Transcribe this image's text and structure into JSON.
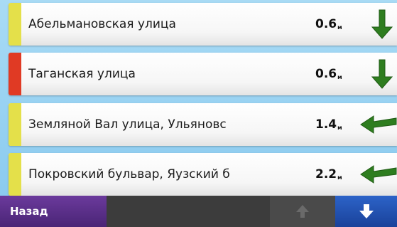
{
  "colors": {
    "background": "#8fcdf1",
    "stripe_yellow": "#e4e04a",
    "stripe_red": "#e03a24",
    "arrow_green": "#2e7d1f",
    "back_button": "#5a2e88",
    "down_button": "#2458b8"
  },
  "list": {
    "items": [
      {
        "name": "Абельмановская улица",
        "distance": "0.6",
        "unit": "м",
        "stripe": "yellow",
        "direction": "down",
        "direction_icon": "arrow-down-icon"
      },
      {
        "name": "Таганская улица",
        "distance": "0.6",
        "unit": "м",
        "stripe": "red",
        "direction": "down",
        "direction_icon": "arrow-down-icon"
      },
      {
        "name": "Земляной Вал улица, Ульяновс",
        "distance": "1.4",
        "unit": "м",
        "stripe": "yellow",
        "direction": "left",
        "direction_icon": "arrow-left-icon"
      },
      {
        "name": "Покровский бульвар, Яузский б",
        "distance": "2.2",
        "unit": "м",
        "stripe": "yellow",
        "direction": "left",
        "direction_icon": "arrow-left-icon"
      }
    ]
  },
  "toolbar": {
    "back_label": "Назад",
    "scroll_up_icon": "arrow-up-icon",
    "scroll_down_icon": "arrow-down-icon"
  }
}
